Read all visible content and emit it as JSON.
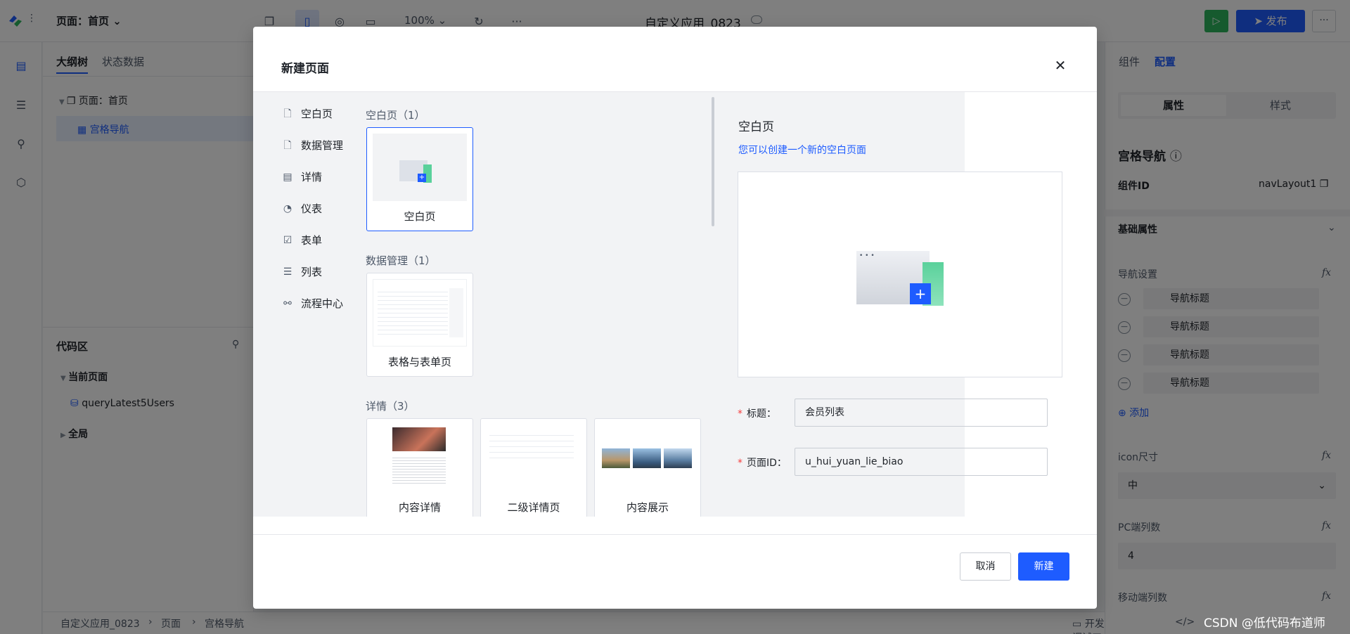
{
  "topbar": {
    "page_select": "页面：首页",
    "zoom": "100%",
    "app_title": "自定义应用_0823",
    "publish_label": "发布",
    "more_label": "···"
  },
  "left_panel": {
    "tabs": [
      "大纲树",
      "状态数据"
    ],
    "tree": {
      "root": "页面：首页",
      "child": "宫格导航"
    },
    "code_area_title": "代码区",
    "code_tree": {
      "current_page": "当前页面",
      "query": "queryLatest5Users",
      "global": "全局"
    }
  },
  "right_panel": {
    "tabs": [
      "组件",
      "配置"
    ],
    "segments": [
      "属性",
      "样式"
    ],
    "component_name": "宫格导航",
    "component_id_label": "组件ID",
    "component_id": "navLayout1",
    "basic_props": "基础属性",
    "nav_settings": "导航设置",
    "nav_items": [
      "导航标题",
      "导航标题",
      "导航标题",
      "导航标题"
    ],
    "add_label": "添加",
    "icon_size_label": "icon尺寸",
    "icon_size_value": "中",
    "pc_cols_label": "PC端列数",
    "pc_cols_value": "4",
    "mobile_cols_label": "移动端列数"
  },
  "bottombar": {
    "breadcrumb": [
      "自定义应用_0823",
      "页面",
      "宫格导航"
    ],
    "dev_tools": "开发调试工具"
  },
  "modal": {
    "title": "新建页面",
    "categories": [
      "空白页",
      "数据管理",
      "详情",
      "仪表",
      "表单",
      "列表",
      "流程中心"
    ],
    "sections": [
      {
        "title": "空白页（1）",
        "cards": [
          "空白页"
        ]
      },
      {
        "title": "数据管理（1）",
        "cards": [
          "表格与表单页"
        ]
      },
      {
        "title": "详情（3）",
        "cards": [
          "内容详情",
          "二级详情页",
          "内容展示"
        ]
      }
    ],
    "preview": {
      "title": "空白页",
      "description": "您可以创建一个新的空白页面"
    },
    "form": {
      "title_label": "标题：",
      "title_value": "会员列表",
      "page_id_label": "页面ID：",
      "page_id_value": "u_hui_yuan_lie_biao"
    },
    "cancel_label": "取消",
    "create_label": "新建"
  },
  "watermark": "CSDN @低代码布道师",
  "colors": {
    "primary": "#1e5cff",
    "success": "#2db55d",
    "required": "#f53f3f"
  }
}
